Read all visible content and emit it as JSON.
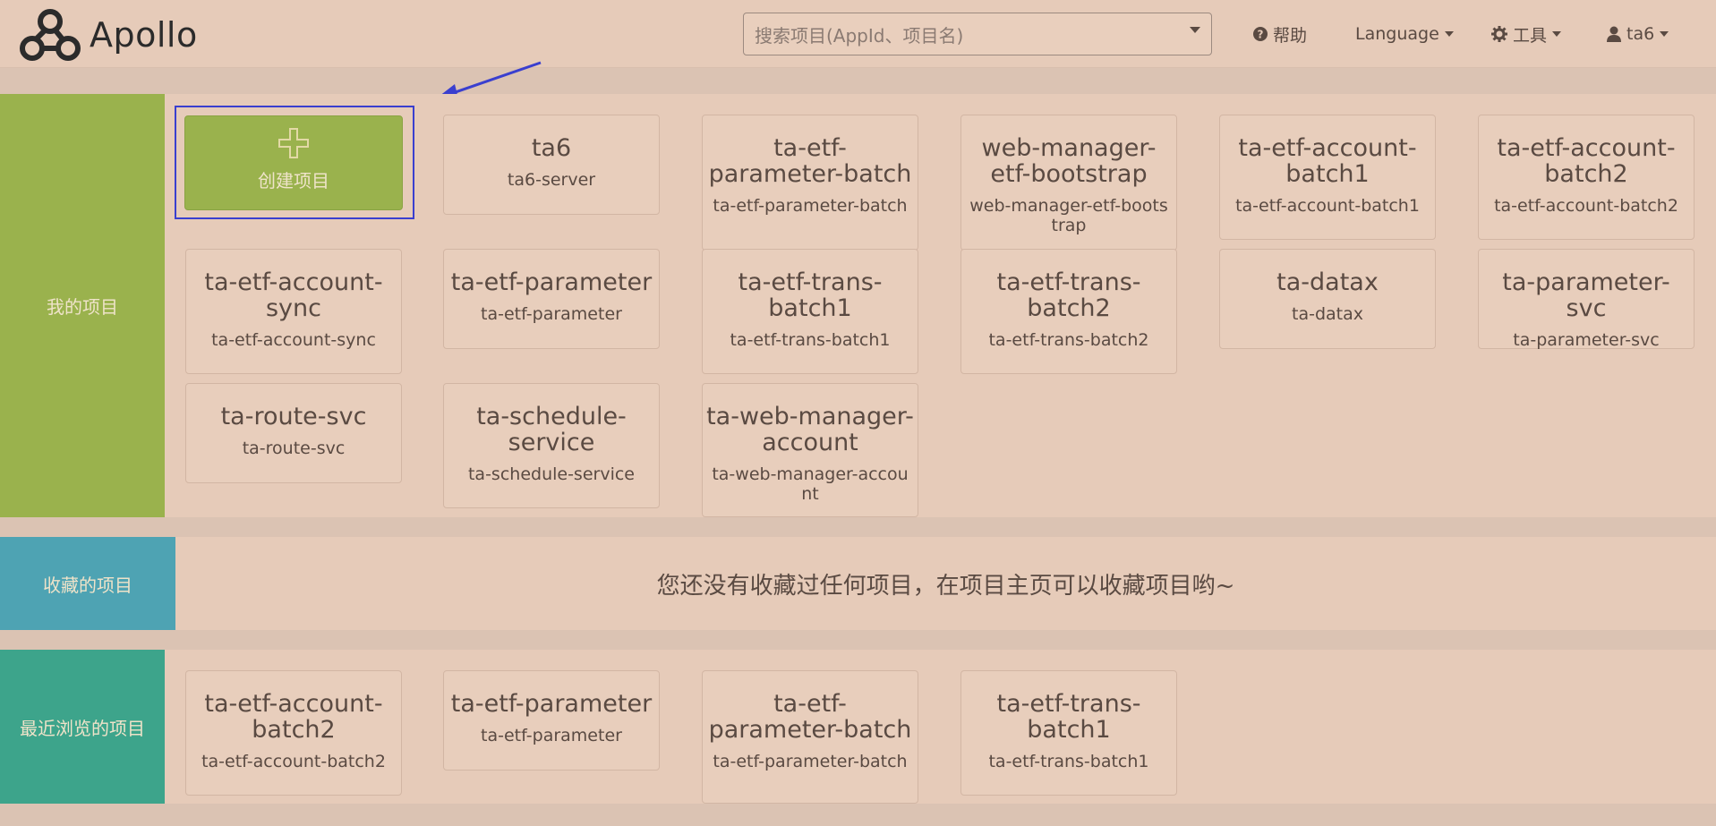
{
  "header": {
    "brand": "Apollo",
    "search_placeholder": "搜索项目(AppId、项目名)",
    "help": "帮助",
    "language": "Language",
    "tools": "工具",
    "user": "ta6"
  },
  "my_projects": {
    "label": "我的项目",
    "create_label": "创建项目",
    "items": [
      {
        "title": "ta6",
        "appid": "ta6-server"
      },
      {
        "title": "ta-etf-parameter-batch",
        "appid": "ta-etf-parameter-batch"
      },
      {
        "title": "web-manager-etf-bootstrap",
        "appid": "web-manager-etf-bootstrap"
      },
      {
        "title": "ta-etf-account-batch1",
        "appid": "ta-etf-account-batch1"
      },
      {
        "title": "ta-etf-account-batch2",
        "appid": "ta-etf-account-batch2"
      },
      {
        "title": "ta-etf-account-sync",
        "appid": "ta-etf-account-sync"
      },
      {
        "title": "ta-etf-parameter",
        "appid": "ta-etf-parameter"
      },
      {
        "title": "ta-etf-trans-batch1",
        "appid": "ta-etf-trans-batch1"
      },
      {
        "title": "ta-etf-trans-batch2",
        "appid": "ta-etf-trans-batch2"
      },
      {
        "title": "ta-datax",
        "appid": "ta-datax"
      },
      {
        "title": "ta-parameter-svc",
        "appid": "ta-parameter-svc"
      },
      {
        "title": "ta-route-svc",
        "appid": "ta-route-svc"
      },
      {
        "title": "ta-schedule-service",
        "appid": "ta-schedule-service"
      },
      {
        "title": "ta-web-manager-account",
        "appid": "ta-web-manager-account"
      }
    ]
  },
  "favorites": {
    "label": "收藏的项目",
    "empty_text": "您还没有收藏过任何项目，在项目主页可以收藏项目哟~"
  },
  "recent": {
    "label": "最近浏览的项目",
    "items": [
      {
        "title": "ta-etf-account-batch2",
        "appid": "ta-etf-account-batch2"
      },
      {
        "title": "ta-etf-parameter",
        "appid": "ta-etf-parameter"
      },
      {
        "title": "ta-etf-parameter-batch",
        "appid": "ta-etf-parameter-batch"
      },
      {
        "title": "ta-etf-trans-batch1",
        "appid": "ta-etf-trans-batch1"
      }
    ]
  },
  "colors": {
    "my_projects_accent": "#9ab24d",
    "favorites_accent": "#4ea3b3",
    "recent_accent": "#3da48b",
    "annotation_arrow": "#3a3fcf"
  }
}
